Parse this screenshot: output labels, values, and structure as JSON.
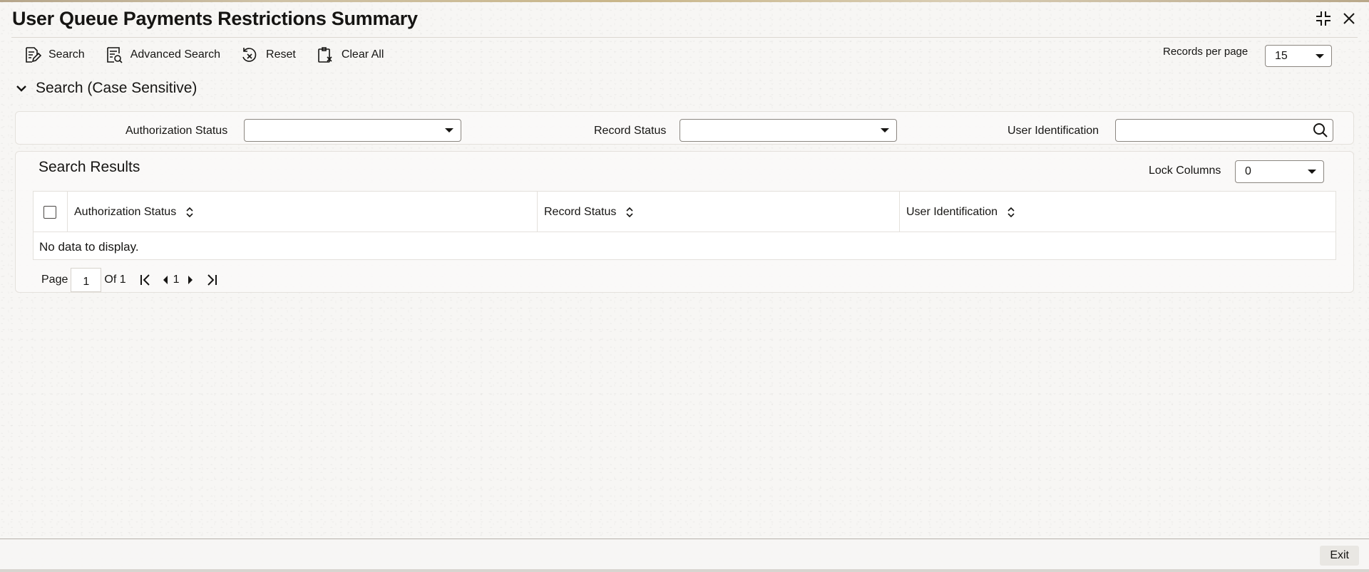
{
  "window": {
    "title": "User Queue Payments Restrictions Summary"
  },
  "toolbar": {
    "search": "Search",
    "advanced_search": "Advanced Search",
    "reset": "Reset",
    "clear_all": "Clear All",
    "records_per_page_label": "Records per page",
    "records_per_page_value": "15"
  },
  "search_section": {
    "title": "Search (Case Sensitive)",
    "authorization_status_label": "Authorization Status",
    "authorization_status_value": "",
    "record_status_label": "Record Status",
    "record_status_value": "",
    "user_identification_label": "User Identification",
    "user_identification_value": ""
  },
  "results": {
    "title": "Search Results",
    "lock_columns_label": "Lock Columns",
    "lock_columns_value": "0",
    "columns": [
      "Authorization Status",
      "Record Status",
      "User Identification"
    ],
    "empty_message": "No data to display."
  },
  "pagination": {
    "page_label": "Page",
    "current_page": "1",
    "of_label": "Of 1",
    "page_link": "1"
  },
  "footer": {
    "exit": "Exit"
  },
  "icons": [
    "search-doc-icon",
    "advanced-search-icon",
    "reset-icon",
    "clear-all-icon",
    "collapse-window-icon",
    "close-icon",
    "chevron-down-icon",
    "magnifier-icon",
    "sort-icon",
    "first-page-icon",
    "prev-page-icon",
    "next-page-icon",
    "last-page-icon"
  ]
}
